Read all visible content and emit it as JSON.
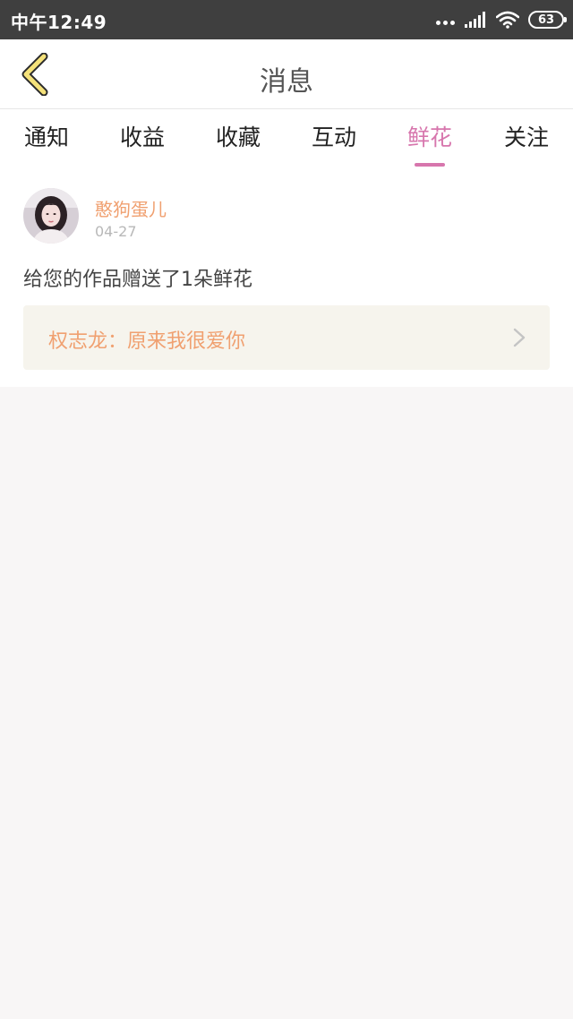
{
  "status_bar": {
    "time": "中午12:49",
    "battery": "63"
  },
  "nav": {
    "title": "消息"
  },
  "tabs": [
    {
      "label": "通知",
      "active": false
    },
    {
      "label": "收益",
      "active": false
    },
    {
      "label": "收藏",
      "active": false
    },
    {
      "label": "互动",
      "active": false
    },
    {
      "label": "鲜花",
      "active": true
    },
    {
      "label": "关注",
      "active": false
    }
  ],
  "message": {
    "username": "憨狗蛋儿",
    "date": "04-27",
    "text": "给您的作品赠送了1朵鲜花",
    "work_title": "权志龙：原来我很爱你"
  },
  "colors": {
    "accent_pink": "#d776ad",
    "accent_orange": "#f0a070",
    "back_icon_yellow": "#f5e27a"
  },
  "icons": {
    "back": "chevron-left-icon",
    "work_arrow": "chevron-right-icon",
    "signal": "signal-icon",
    "wifi": "wifi-icon",
    "battery": "battery-icon",
    "more": "more-dots-icon"
  }
}
